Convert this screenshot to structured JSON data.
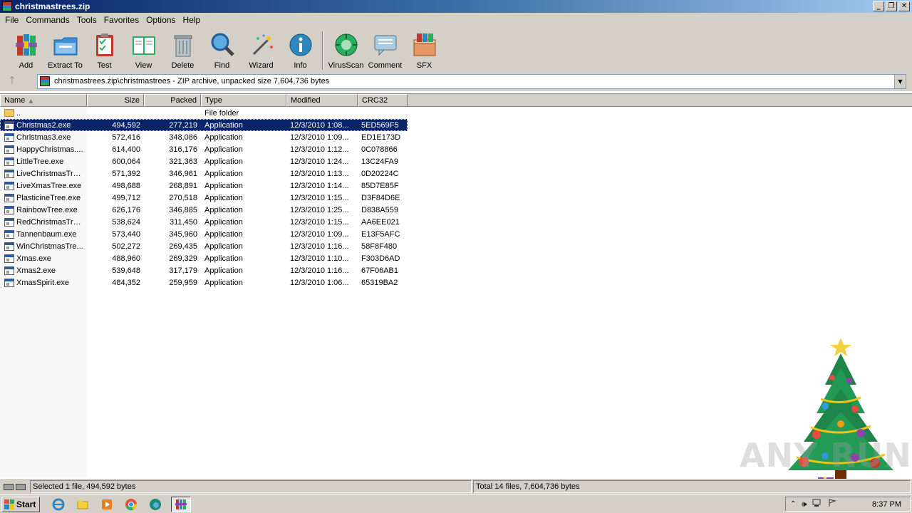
{
  "window": {
    "title": "christmastrees.zip"
  },
  "menu": [
    "File",
    "Commands",
    "Tools",
    "Favorites",
    "Options",
    "Help"
  ],
  "toolbar": {
    "buttons": [
      {
        "label": "Add",
        "icon": "add-archive-icon"
      },
      {
        "label": "Extract To",
        "icon": "extract-folder-icon"
      },
      {
        "label": "Test",
        "icon": "test-clipboard-icon"
      },
      {
        "label": "View",
        "icon": "view-book-icon"
      },
      {
        "label": "Delete",
        "icon": "trash-icon"
      },
      {
        "label": "Find",
        "icon": "magnifier-icon"
      },
      {
        "label": "Wizard",
        "icon": "magic-wand-icon"
      },
      {
        "label": "Info",
        "icon": "info-icon"
      },
      {
        "label": "VirusScan",
        "icon": "virus-scan-icon"
      },
      {
        "label": "Comment",
        "icon": "comment-icon"
      },
      {
        "label": "SFX",
        "icon": "sfx-box-icon"
      }
    ]
  },
  "address": {
    "path": "christmastrees.zip\\christmastrees - ZIP archive, unpacked size 7,604,736 bytes"
  },
  "columns": {
    "name": "Name",
    "size": "Size",
    "packed": "Packed",
    "type": "Type",
    "modified": "Modified",
    "crc": "CRC32"
  },
  "parent_row": {
    "name": "..",
    "type": "File folder"
  },
  "files": [
    {
      "name": "Christmas2.exe",
      "size": "494,592",
      "packed": "277,219",
      "type": "Application",
      "modified": "12/3/2010 1:08...",
      "crc": "5ED569F5",
      "selected": true
    },
    {
      "name": "Christmas3.exe",
      "size": "572,416",
      "packed": "348,086",
      "type": "Application",
      "modified": "12/3/2010 1:09...",
      "crc": "ED1E173D"
    },
    {
      "name": "HappyChristmas....",
      "size": "614,400",
      "packed": "316,176",
      "type": "Application",
      "modified": "12/3/2010 1:12...",
      "crc": "0C078866"
    },
    {
      "name": "LittleTree.exe",
      "size": "600,064",
      "packed": "321,363",
      "type": "Application",
      "modified": "12/3/2010 1:24...",
      "crc": "13C24FA9"
    },
    {
      "name": "LiveChristmasTre...",
      "size": "571,392",
      "packed": "346,961",
      "type": "Application",
      "modified": "12/3/2010 1:13...",
      "crc": "0D20224C"
    },
    {
      "name": "LiveXmasTree.exe",
      "size": "498,688",
      "packed": "268,891",
      "type": "Application",
      "modified": "12/3/2010 1:14...",
      "crc": "85D7E85F"
    },
    {
      "name": "PlasticineTree.exe",
      "size": "499,712",
      "packed": "270,518",
      "type": "Application",
      "modified": "12/3/2010 1:15...",
      "crc": "D3F84D6E"
    },
    {
      "name": "RainbowTree.exe",
      "size": "626,176",
      "packed": "346,885",
      "type": "Application",
      "modified": "12/3/2010 1:25...",
      "crc": "D838A559"
    },
    {
      "name": "RedChristmasTre...",
      "size": "538,624",
      "packed": "311,450",
      "type": "Application",
      "modified": "12/3/2010 1:15...",
      "crc": "AA6EE021"
    },
    {
      "name": "Tannenbaum.exe",
      "size": "573,440",
      "packed": "345,960",
      "type": "Application",
      "modified": "12/3/2010 1:09...",
      "crc": "E13F5AFC"
    },
    {
      "name": "WinChristmasTre...",
      "size": "502,272",
      "packed": "269,435",
      "type": "Application",
      "modified": "12/3/2010 1:16...",
      "crc": "58F8F480"
    },
    {
      "name": "Xmas.exe",
      "size": "488,960",
      "packed": "269,329",
      "type": "Application",
      "modified": "12/3/2010 1:10...",
      "crc": "F303D6AD"
    },
    {
      "name": "Xmas2.exe",
      "size": "539,648",
      "packed": "317,179",
      "type": "Application",
      "modified": "12/3/2010 1:16...",
      "crc": "67F06AB1"
    },
    {
      "name": "XmasSpirit.exe",
      "size": "484,352",
      "packed": "259,959",
      "type": "Application",
      "modified": "12/3/2010 1:06...",
      "crc": "65319BA2"
    }
  ],
  "status": {
    "left": "Selected 1 file, 494,592 bytes",
    "right": "Total 14 files, 7,604,736 bytes"
  },
  "taskbar": {
    "start": "Start",
    "apps": [
      "internet-explorer-icon",
      "file-explorer-icon",
      "media-player-icon",
      "chrome-icon",
      "edge-icon",
      "winrar-icon"
    ],
    "clock": "8:37 PM"
  },
  "watermark": "ANY RUN",
  "colors": {
    "selection": "#0a246a",
    "chrome": "#d4d0c8"
  }
}
